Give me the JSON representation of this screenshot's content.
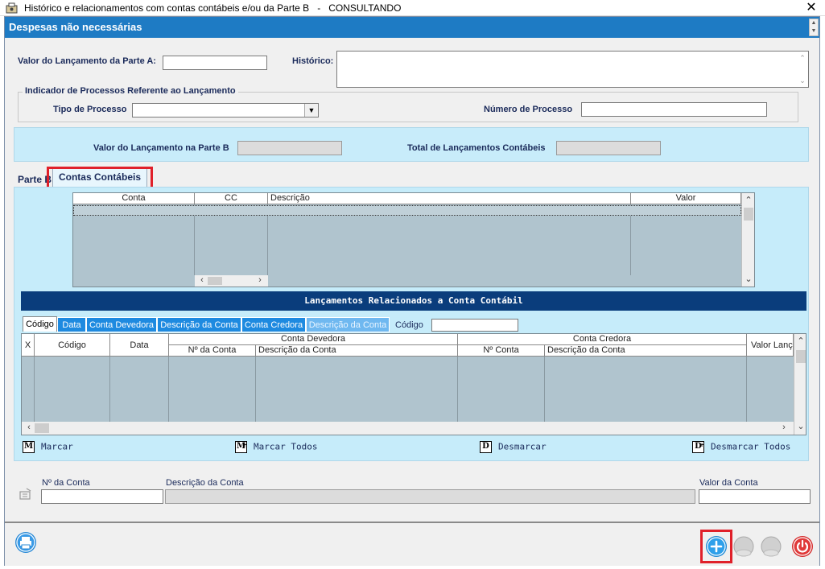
{
  "window": {
    "title": "Histórico e relacionamentos com contas contábeis e/ou da Parte B   -   CONSULTANDO",
    "close_glyph": "✕"
  },
  "dialog": {
    "header_title": "Despesas não necessárias"
  },
  "form": {
    "valor_parte_a_label": "Valor do Lançamento da Parte A:",
    "valor_parte_a_value": "",
    "historico_label": "Histórico:",
    "historico_value": "",
    "indicador_group_label": "Indicador de Processos Referente ao Lançamento",
    "tipo_processo_label": "Tipo de Processo",
    "tipo_processo_value": "",
    "numero_processo_label": "Número de Processo",
    "numero_processo_value": "",
    "valor_parte_b_label": "Valor do Lançamento na Parte B",
    "valor_parte_b_value": "",
    "total_lancamentos_label": "Total de Lançamentos Contábeis",
    "total_lancamentos_value": ""
  },
  "tabs": {
    "parte_b": "Parte B",
    "contas_contabeis": "Contas Contábeis"
  },
  "accounts_grid": {
    "columns": [
      "Conta",
      "CC",
      "Descrição",
      "Valor"
    ]
  },
  "related": {
    "title": "Lançamentos Relacionados a Conta Contábil",
    "subtabs": [
      "Código",
      "Data",
      "Conta Devedora",
      "Descrição da Conta",
      "Conta Credora",
      "Descrição da Conta"
    ],
    "search_label": "Código",
    "search_value": "",
    "grid": {
      "top_headers": [
        "X",
        "Código",
        "Data",
        "Conta Devedora",
        "Conta Credora",
        "Valor Lanç"
      ],
      "sub_headers": [
        "Nº da Conta",
        "Descrição da Conta",
        "Nº Conta",
        "Descrição da Conta"
      ]
    },
    "actions": [
      {
        "key": "M",
        "label": "Marcar"
      },
      {
        "key": "M",
        "label": "Marcar Todos"
      },
      {
        "key": "D",
        "label": "Desmarcar"
      },
      {
        "key": "D",
        "label": "Desmarcar Todos"
      }
    ]
  },
  "account_fields": {
    "numero_label": "Nº da Conta",
    "numero_value": "",
    "descricao_label": "Descrição da Conta",
    "descricao_value": "",
    "valor_label": "Valor da Conta",
    "valor_value": ""
  },
  "colors": {
    "header_blue": "#1e7bc4",
    "panel_light_blue": "#c8ecfa",
    "nav_dark_blue": "#0a3d7c",
    "highlight_red": "#e0202a",
    "add_button": "#1e8ad6",
    "power_button": "#d42a2a"
  },
  "icons": [
    "app-icon",
    "close-icon",
    "print-icon",
    "add-icon",
    "disabled-action-icon",
    "power-icon",
    "edit-icon"
  ]
}
